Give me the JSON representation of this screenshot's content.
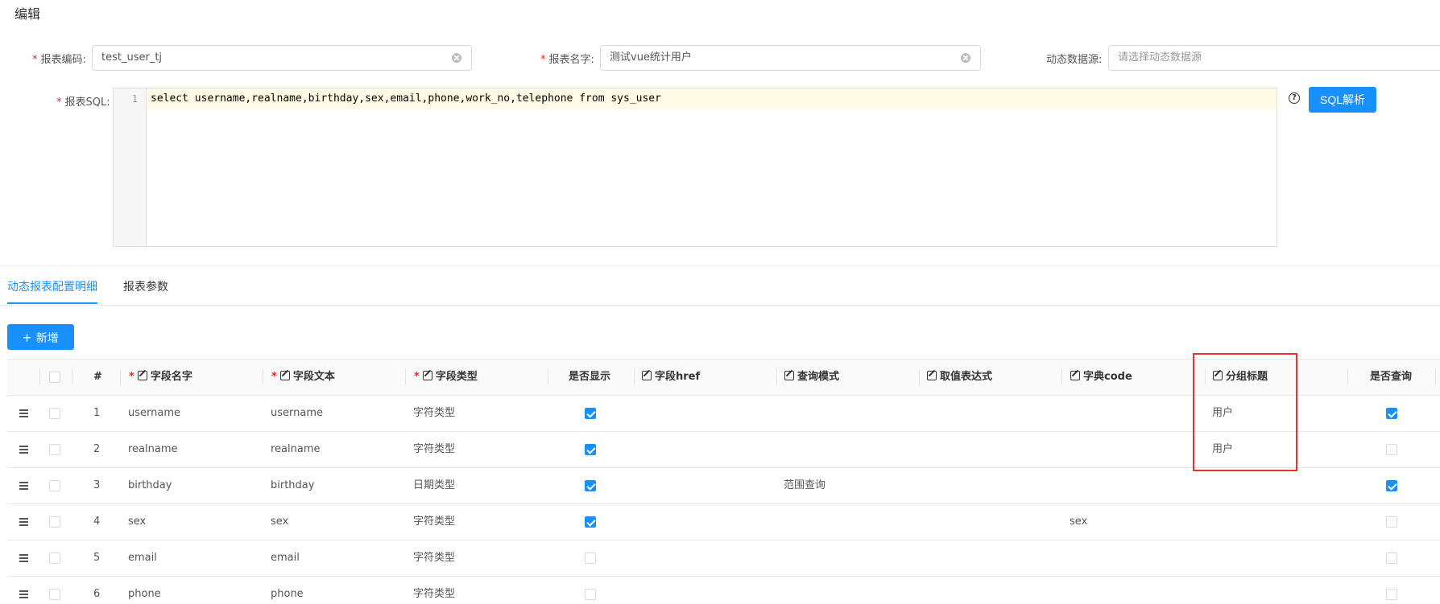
{
  "page": {
    "title": "编辑"
  },
  "form": {
    "report_code": {
      "label": "报表编码:",
      "value": "test_user_tj"
    },
    "report_name": {
      "label": "报表名字:",
      "value": "测试vue统计用户"
    },
    "datasource": {
      "label": "动态数据源:",
      "placeholder": "请选择动态数据源"
    },
    "sql": {
      "label": "报表SQL:",
      "line_number": "1",
      "code": "select username,realname,birthday,sex,email,phone,work_no,telephone from sys_user"
    },
    "parse_button": "SQL解析"
  },
  "tabs": [
    {
      "label": "动态报表配置明细",
      "active": true
    },
    {
      "label": "报表参数",
      "active": false
    }
  ],
  "add_button": {
    "icon": "+",
    "label": "新增"
  },
  "table": {
    "headers": {
      "index": "#",
      "field_name": "字段名字",
      "field_text": "字段文本",
      "field_type": "字段类型",
      "is_show": "是否显示",
      "field_href": "字段href",
      "query_mode": "查询模式",
      "value_expr": "取值表达式",
      "dict_code": "字典code",
      "group_title": "分组标题",
      "is_query": "是否查询"
    },
    "rows": [
      {
        "index": "1",
        "field_name": "username",
        "field_text": "username",
        "field_type": "字符类型",
        "is_show": true,
        "query_mode": "",
        "dict_code": "",
        "group_title": "用户",
        "is_query": true
      },
      {
        "index": "2",
        "field_name": "realname",
        "field_text": "realname",
        "field_type": "字符类型",
        "is_show": true,
        "query_mode": "",
        "dict_code": "",
        "group_title": "用户",
        "is_query": false
      },
      {
        "index": "3",
        "field_name": "birthday",
        "field_text": "birthday",
        "field_type": "日期类型",
        "is_show": true,
        "query_mode": "范围查询",
        "dict_code": "",
        "group_title": "",
        "is_query": true
      },
      {
        "index": "4",
        "field_name": "sex",
        "field_text": "sex",
        "field_type": "字符类型",
        "is_show": true,
        "query_mode": "",
        "dict_code": "sex",
        "group_title": "",
        "is_query": false
      },
      {
        "index": "5",
        "field_name": "email",
        "field_text": "email",
        "field_type": "字符类型",
        "is_show": false,
        "query_mode": "",
        "dict_code": "",
        "group_title": "",
        "is_query": false
      },
      {
        "index": "6",
        "field_name": "phone",
        "field_text": "phone",
        "field_type": "字符类型",
        "is_show": false,
        "query_mode": "",
        "dict_code": "",
        "group_title": "",
        "is_query": false
      }
    ]
  },
  "colors": {
    "primary": "#1890ff",
    "required": "#f5222d",
    "highlight": "#e83131"
  }
}
